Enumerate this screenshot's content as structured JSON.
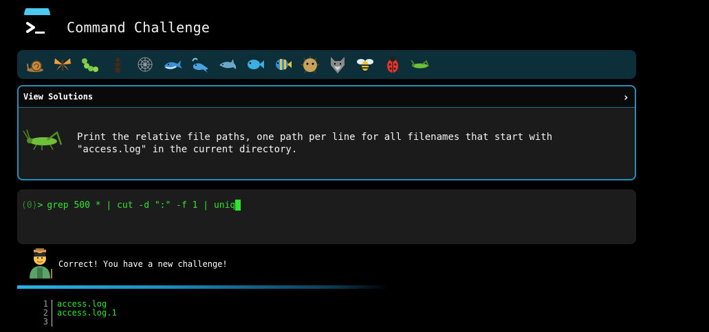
{
  "app": {
    "title": "Command Challenge"
  },
  "badges": {
    "items": [
      "snail-icon",
      "butterfly-icon",
      "caterpillar-icon",
      "ant-icon",
      "spider-web-icon",
      "whale-icon",
      "spouting-whale-icon",
      "dolphin-icon",
      "fish-icon",
      "tropical-fish-icon",
      "blowfish-icon",
      "wolf-icon",
      "bee-icon",
      "ladybug-icon",
      "cricket-icon"
    ]
  },
  "challenge": {
    "header_label": "View Solutions",
    "chevron": "›",
    "text": "Print the relative file paths, one path per line for all filenames that start with\n\"access.log\" in the current directory."
  },
  "terminal": {
    "status": "(0)",
    "prompt": ">",
    "command": "grep 500 * | cut -d \":\" -f 1 | uniq"
  },
  "feedback": {
    "message": "Correct! You have a new challenge!"
  },
  "output": {
    "lines": [
      {
        "num": "1",
        "text": "access.log"
      },
      {
        "num": "2",
        "text": "access.log.1"
      },
      {
        "num": "3",
        "text": ""
      }
    ]
  },
  "colors": {
    "accent": "#2a8fb8",
    "terminal_green": "#2ee52e",
    "badge_bar": "#0c2f3a"
  }
}
